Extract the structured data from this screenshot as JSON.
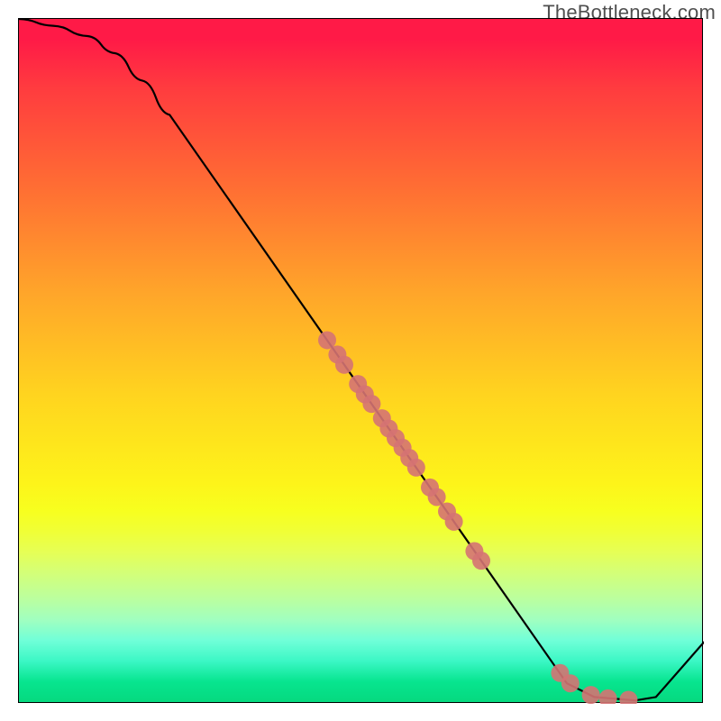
{
  "attribution": "TheBottleneck.com",
  "chart_data": {
    "type": "line",
    "title": "",
    "xlabel": "",
    "ylabel": "",
    "xlim": [
      0,
      100
    ],
    "ylim": [
      0,
      100
    ],
    "background": "rainbow-vertical-gradient",
    "curve": [
      {
        "x": 0,
        "y": 100
      },
      {
        "x": 5,
        "y": 99
      },
      {
        "x": 10,
        "y": 97.5
      },
      {
        "x": 14,
        "y": 95
      },
      {
        "x": 18,
        "y": 91
      },
      {
        "x": 22,
        "y": 86
      },
      {
        "x": 80,
        "y": 3
      },
      {
        "x": 84,
        "y": 1
      },
      {
        "x": 90,
        "y": 0.5
      },
      {
        "x": 93,
        "y": 1
      },
      {
        "x": 100,
        "y": 9
      }
    ],
    "curve_note": "linear segments; first segment curved (shoulder), final upturn after flat minimum",
    "points": [
      {
        "x": 45.0,
        "y": 53.1
      },
      {
        "x": 46.5,
        "y": 51.0
      },
      {
        "x": 47.5,
        "y": 49.5
      },
      {
        "x": 49.5,
        "y": 46.7
      },
      {
        "x": 50.5,
        "y": 45.2
      },
      {
        "x": 51.5,
        "y": 43.8
      },
      {
        "x": 53.0,
        "y": 41.7
      },
      {
        "x": 54.0,
        "y": 40.2
      },
      {
        "x": 55.0,
        "y": 38.8
      },
      {
        "x": 56.0,
        "y": 37.4
      },
      {
        "x": 57.0,
        "y": 35.9
      },
      {
        "x": 58.0,
        "y": 34.5
      },
      {
        "x": 60.0,
        "y": 31.6
      },
      {
        "x": 61.0,
        "y": 30.2
      },
      {
        "x": 62.5,
        "y": 28.1
      },
      {
        "x": 63.5,
        "y": 26.6
      },
      {
        "x": 66.5,
        "y": 22.3
      },
      {
        "x": 67.5,
        "y": 20.9
      },
      {
        "x": 79.0,
        "y": 4.5
      },
      {
        "x": 80.5,
        "y": 3.0
      },
      {
        "x": 83.5,
        "y": 1.3
      },
      {
        "x": 86.0,
        "y": 0.8
      },
      {
        "x": 89.0,
        "y": 0.6
      }
    ],
    "point_style": {
      "shape": "circle-large",
      "color": "#d57373",
      "radius_px": 10
    }
  }
}
